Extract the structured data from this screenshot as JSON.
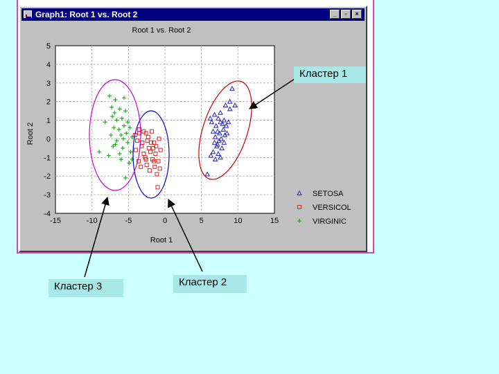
{
  "window": {
    "title": "Graph1: Root 1 vs. Root 2",
    "buttons": {
      "minimize": "_",
      "maximize": "▫",
      "close": "×"
    }
  },
  "chart_data": {
    "type": "scatter",
    "title": "Root 1 vs. Root 2",
    "xlabel": "Root 1",
    "ylabel": "Root 2",
    "xlim": [
      -15,
      15
    ],
    "ylim": [
      -4,
      5
    ],
    "xticks": [
      "-15",
      "-10",
      "-5",
      "0",
      "5",
      "10",
      "15"
    ],
    "yticks": [
      "-4",
      "-3",
      "-2",
      "-1",
      "0",
      "1",
      "2",
      "3",
      "4",
      "5"
    ],
    "grid": true,
    "legend_position": "bottom-right",
    "series": [
      {
        "name": "SETOSA",
        "marker": "triangle",
        "color": "#2222cc",
        "points": [
          [
            9.2,
            2.7
          ],
          [
            8.9,
            2.0
          ],
          [
            9.6,
            1.8
          ],
          [
            8.3,
            1.8
          ],
          [
            7.6,
            1.4
          ],
          [
            8.9,
            1.6
          ],
          [
            6.8,
            1.3
          ],
          [
            7.3,
            1.1
          ],
          [
            8.1,
            1.0
          ],
          [
            6.2,
            1.1
          ],
          [
            7.6,
            0.9
          ],
          [
            8.7,
            0.9
          ],
          [
            7.0,
            0.7
          ],
          [
            7.9,
            0.8
          ],
          [
            8.4,
            0.7
          ],
          [
            6.6,
            0.4
          ],
          [
            7.2,
            0.4
          ],
          [
            8.0,
            0.5
          ],
          [
            7.5,
            0.3
          ],
          [
            8.2,
            0.2
          ],
          [
            6.9,
            0.1
          ],
          [
            7.7,
            0.0
          ],
          [
            7.4,
            -0.1
          ],
          [
            6.8,
            -0.2
          ],
          [
            8.1,
            -0.2
          ],
          [
            7.1,
            -0.4
          ],
          [
            7.8,
            -0.5
          ],
          [
            6.6,
            -0.7
          ],
          [
            7.3,
            -0.8
          ],
          [
            6.3,
            -0.9
          ],
          [
            7.6,
            -1.0
          ],
          [
            6.9,
            -1.1
          ],
          [
            7.2,
            -0.3
          ],
          [
            8.5,
            0.3
          ],
          [
            6.4,
            0.9
          ],
          [
            5.8,
            -1.9
          ]
        ]
      },
      {
        "name": "VERSICOL",
        "marker": "square",
        "color": "#dd2222",
        "points": [
          [
            -4.1,
            0.2
          ],
          [
            -3.5,
            0.3
          ],
          [
            -2.6,
            0.3
          ],
          [
            -1.8,
            0.4
          ],
          [
            -3.8,
            -0.1
          ],
          [
            -3.1,
            -0.2
          ],
          [
            -2.4,
            -0.1
          ],
          [
            -1.5,
            -0.2
          ],
          [
            -0.8,
            0.0
          ],
          [
            -3.2,
            -0.4
          ],
          [
            -2.2,
            -0.5
          ],
          [
            -1.6,
            -0.5
          ],
          [
            -0.6,
            -0.6
          ],
          [
            -4.0,
            -0.6
          ],
          [
            -2.9,
            -0.8
          ],
          [
            -2.0,
            -0.7
          ],
          [
            -1.3,
            -0.8
          ],
          [
            -2.7,
            -1.0
          ],
          [
            -1.7,
            -1.1
          ],
          [
            -0.9,
            -1.2
          ],
          [
            -3.6,
            -1.2
          ],
          [
            -2.5,
            -1.4
          ],
          [
            -1.4,
            -1.5
          ],
          [
            -0.7,
            -1.6
          ],
          [
            -2.1,
            -1.7
          ],
          [
            -1.1,
            -1.9
          ],
          [
            -3.3,
            -1.5
          ],
          [
            -2.3,
            0.1
          ],
          [
            -1.9,
            -0.2
          ],
          [
            -1.2,
            -0.4
          ],
          [
            -2.6,
            -1.1
          ],
          [
            -1.5,
            -1.2
          ],
          [
            -1.0,
            -2.6
          ],
          [
            -2.9,
            0.4
          ],
          [
            -3.5,
            0.5
          ]
        ]
      },
      {
        "name": "VIRGINIC",
        "marker": "plus",
        "color": "#22aa22",
        "points": [
          [
            -7.6,
            2.3
          ],
          [
            -6.8,
            2.1
          ],
          [
            -5.6,
            2.2
          ],
          [
            -7.3,
            1.7
          ],
          [
            -6.2,
            1.6
          ],
          [
            -5.4,
            1.5
          ],
          [
            -7.2,
            1.2
          ],
          [
            -5.9,
            1.1
          ],
          [
            -6.6,
            1.0
          ],
          [
            -5.1,
            0.9
          ],
          [
            -7.0,
            0.6
          ],
          [
            -5.6,
            0.7
          ],
          [
            -6.3,
            0.5
          ],
          [
            -4.8,
            0.6
          ],
          [
            -7.4,
            0.2
          ],
          [
            -6.0,
            0.2
          ],
          [
            -5.3,
            0.3
          ],
          [
            -4.5,
            0.1
          ],
          [
            -6.6,
            -0.1
          ],
          [
            -5.1,
            -0.2
          ],
          [
            -7.1,
            -0.4
          ],
          [
            -5.8,
            -0.5
          ],
          [
            -6.2,
            -0.8
          ],
          [
            -4.7,
            -0.7
          ],
          [
            -7.7,
            -0.9
          ],
          [
            -6.0,
            -1.1
          ],
          [
            -4.9,
            -1.3
          ],
          [
            -9.0,
            -0.7
          ],
          [
            -8.2,
            0.9
          ],
          [
            -6.9,
            1.4
          ],
          [
            -4.5,
            -1.1
          ],
          [
            -5.4,
            -2.1
          ],
          [
            -6.8,
            -0.3
          ],
          [
            -5.7,
            0.0
          ]
        ]
      }
    ]
  },
  "callouts": {
    "cluster1": "Кластер 1",
    "cluster2": "Кластер 2",
    "cluster3": "Кластер 3"
  }
}
